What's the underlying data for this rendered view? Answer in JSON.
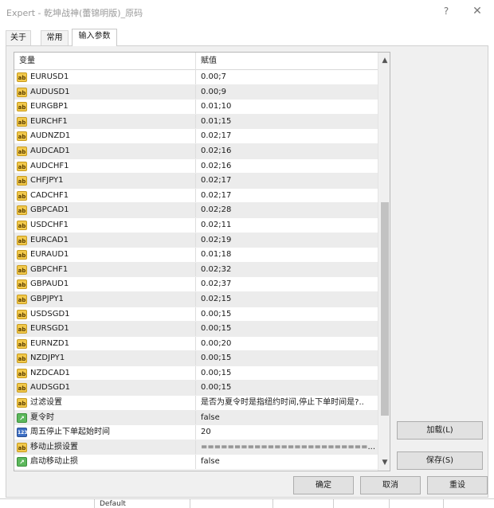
{
  "window": {
    "title": "Expert - 乾坤战神(蕾锦明版)_原码",
    "help_glyph": "?",
    "close_glyph": "✕"
  },
  "tabs": [
    {
      "label": "关于",
      "active": false
    },
    {
      "label": "常用",
      "active": false
    },
    {
      "label": "输入参数",
      "active": true
    }
  ],
  "grid": {
    "headers": {
      "name": "变量",
      "value": "赋值"
    },
    "rows": [
      {
        "icon": "ab",
        "name": "EURUSD1",
        "value": "0.00;7"
      },
      {
        "icon": "ab",
        "name": "AUDUSD1",
        "value": "0.00;9"
      },
      {
        "icon": "ab",
        "name": "EURGBP1",
        "value": "0.01;10"
      },
      {
        "icon": "ab",
        "name": "EURCHF1",
        "value": "0.01;15"
      },
      {
        "icon": "ab",
        "name": "AUDNZD1",
        "value": "0.02;17"
      },
      {
        "icon": "ab",
        "name": "AUDCAD1",
        "value": "0.02;16"
      },
      {
        "icon": "ab",
        "name": "AUDCHF1",
        "value": "0.02;16"
      },
      {
        "icon": "ab",
        "name": "CHFJPY1",
        "value": "0.02;17"
      },
      {
        "icon": "ab",
        "name": "CADCHF1",
        "value": "0.02;17"
      },
      {
        "icon": "ab",
        "name": "GBPCAD1",
        "value": "0.02;28"
      },
      {
        "icon": "ab",
        "name": "USDCHF1",
        "value": "0.02;11"
      },
      {
        "icon": "ab",
        "name": "EURCAD1",
        "value": "0.02;19"
      },
      {
        "icon": "ab",
        "name": "EURAUD1",
        "value": "0.01;18"
      },
      {
        "icon": "ab",
        "name": "GBPCHF1",
        "value": "0.02;32"
      },
      {
        "icon": "ab",
        "name": "GBPAUD1",
        "value": "0.02;37"
      },
      {
        "icon": "ab",
        "name": "GBPJPY1",
        "value": "0.02;15"
      },
      {
        "icon": "ab",
        "name": "USDSGD1",
        "value": "0.00;15"
      },
      {
        "icon": "ab",
        "name": "EURSGD1",
        "value": "0.00;15"
      },
      {
        "icon": "ab",
        "name": "EURNZD1",
        "value": "0.00;20"
      },
      {
        "icon": "ab",
        "name": "NZDJPY1",
        "value": "0.00;15"
      },
      {
        "icon": "ab",
        "name": "NZDCAD1",
        "value": "0.00;15"
      },
      {
        "icon": "ab",
        "name": "AUDSGD1",
        "value": "0.00;15"
      },
      {
        "icon": "ab",
        "name": "过滤设置",
        "value": "是否为夏令时是指纽约时间,停止下单时间是?.."
      },
      {
        "icon": "bool",
        "name": "夏令时",
        "value": "false"
      },
      {
        "icon": "num",
        "name": "周五停止下单起始时间",
        "value": "20"
      },
      {
        "icon": "ab",
        "name": "移动止损设置",
        "value": "=========================..."
      },
      {
        "icon": "bool",
        "name": "启动移动止损",
        "value": "false"
      }
    ]
  },
  "icons": {
    "ab": "ab",
    "bool": "↗",
    "num": "123"
  },
  "scroll": {
    "up": "▲",
    "down": "▼"
  },
  "side_buttons": {
    "load": "加载(L)",
    "save": "保存(S)"
  },
  "footer_buttons": {
    "ok": "确定",
    "cancel": "取消",
    "reset": "重设"
  },
  "background_window": {
    "text": "Default"
  }
}
